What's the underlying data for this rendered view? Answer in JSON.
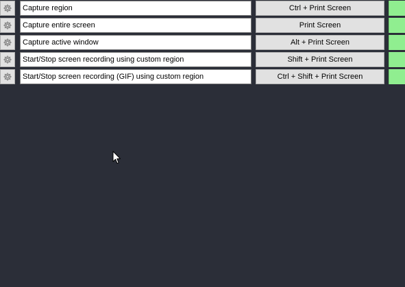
{
  "hotkeys": [
    {
      "description": "Capture region",
      "hotkey": "Ctrl + Print Screen",
      "status_color": "#90ee90"
    },
    {
      "description": "Capture entire screen",
      "hotkey": "Print Screen",
      "status_color": "#90ee90"
    },
    {
      "description": "Capture active window",
      "hotkey": "Alt + Print Screen",
      "status_color": "#90ee90"
    },
    {
      "description": "Start/Stop screen recording using custom region",
      "hotkey": "Shift + Print Screen",
      "status_color": "#90ee90"
    },
    {
      "description": "Start/Stop screen recording (GIF) using custom region",
      "hotkey": "Ctrl + Shift + Print Screen",
      "status_color": "#90ee90"
    }
  ],
  "icons": {
    "settings": "gear-icon",
    "pointer": "mouse-cursor-icon"
  },
  "colors": {
    "background": "#2b2e38",
    "status_ok": "#90ee90"
  }
}
